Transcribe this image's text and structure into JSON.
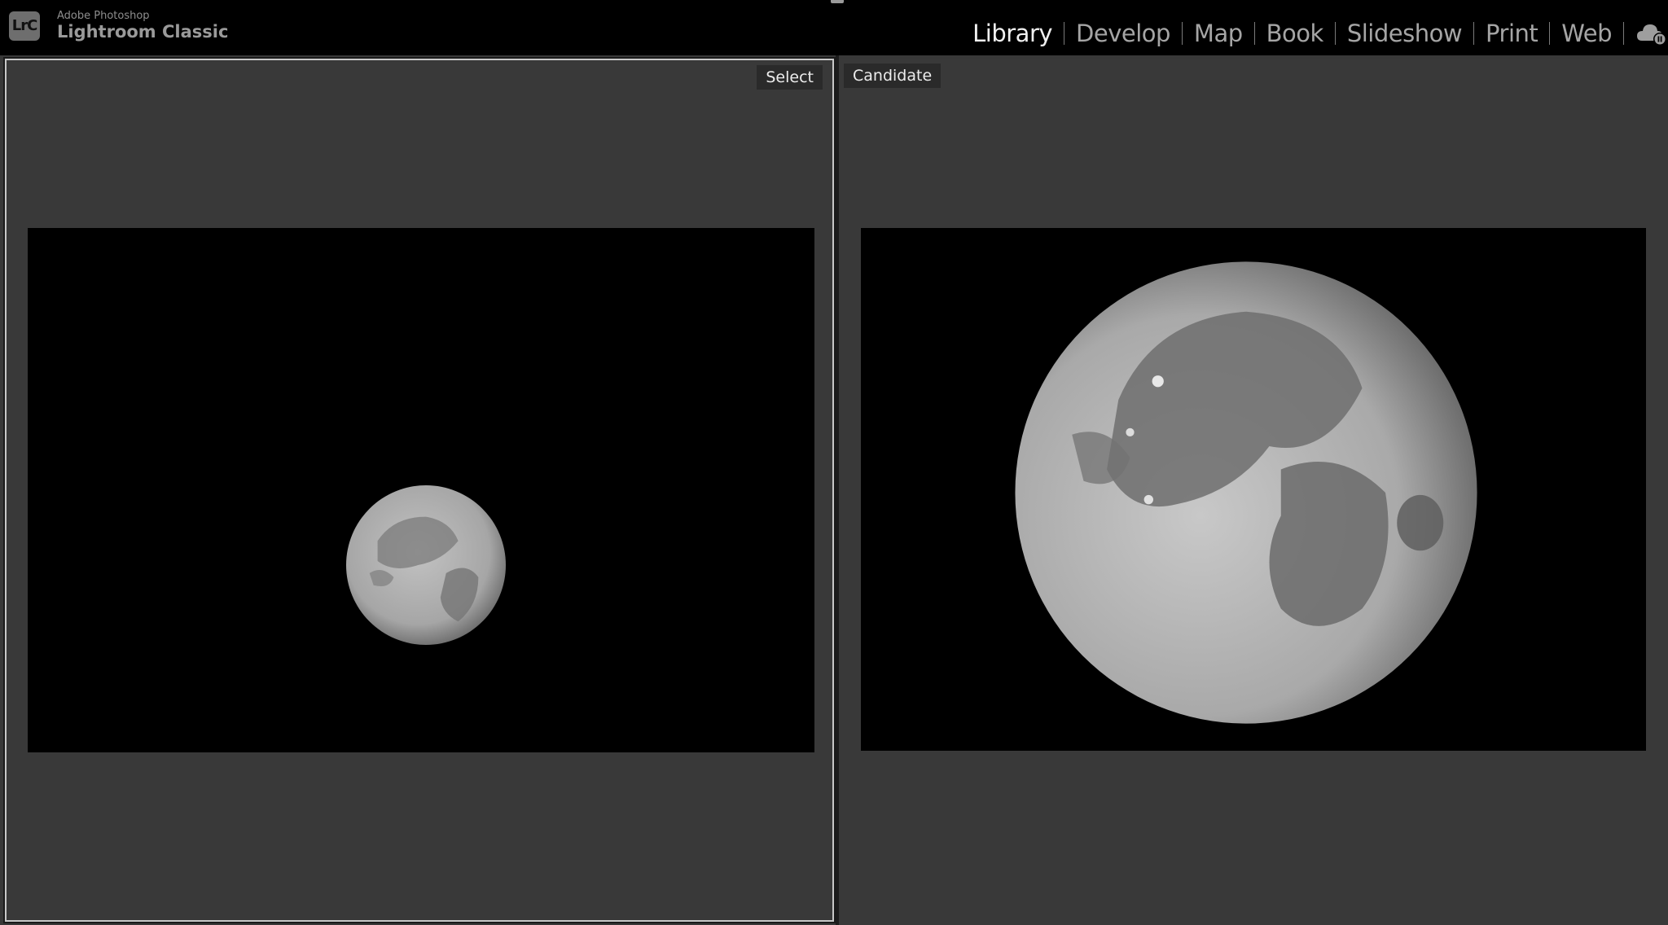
{
  "app": {
    "vendor": "Adobe Photoshop",
    "name": "Lightroom Classic",
    "logo_text": "LrC"
  },
  "modules": [
    {
      "label": "Library",
      "active": true
    },
    {
      "label": "Develop",
      "active": false
    },
    {
      "label": "Map",
      "active": false
    },
    {
      "label": "Book",
      "active": false
    },
    {
      "label": "Slideshow",
      "active": false
    },
    {
      "label": "Print",
      "active": false
    },
    {
      "label": "Web",
      "active": false
    }
  ],
  "cloud_status_icon": "cloud-sync-paused-icon",
  "compare": {
    "select_label": "Select",
    "candidate_label": "Candidate"
  },
  "colors": {
    "background": "#000000",
    "workspace": "#383838",
    "active_module": "#f0f0f0",
    "inactive_module": "#a5a5a5",
    "select_border": "#c8c8c8"
  }
}
